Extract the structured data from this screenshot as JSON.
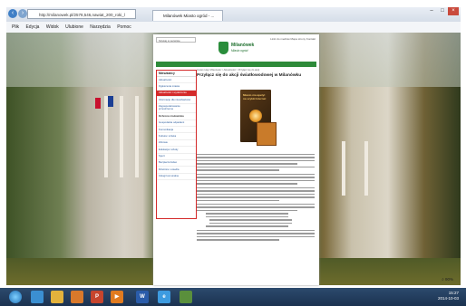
{
  "browser": {
    "address": "http://milanowek.pl/2578,546,nawiat_200_roki_l",
    "tab_title": "Milanówek Miasto ogród - ...",
    "menu": [
      "Plik",
      "Edycja",
      "Widok",
      "Ulubione",
      "Narzędzia",
      "Pomoc"
    ],
    "zoom_label": "⌕ 90%"
  },
  "site": {
    "search_placeholder": "Szukaj w serwisie",
    "top_links": "Linki do mediów   Mapa strony   Kontakt",
    "logo_name": "Milanówek",
    "logo_sub": "Miasto ogród",
    "nav": "Milanówek   Mieszkańcy   Biznes   Turystyka   Kultura i sport   Organizacje pozarządowe   Kontakt",
    "breadcrumb": "Jesteś tutaj: Milanówek > Aktualności > Przyłącz się do akcji",
    "sidebar_title": "Mieszkańcy",
    "sidebar_items": [
      {
        "label": "Aktualności",
        "active": false,
        "cat": false
      },
      {
        "label": "Ogłoszenia miasta",
        "active": false,
        "cat": false
      },
      {
        "label": "Aktualności i wydarzenia",
        "active": true,
        "cat": false
      },
      {
        "label": "Informacje dla mieszkańców",
        "active": false,
        "cat": false
      },
      {
        "label": "Zagospodarowanie przestrzenne",
        "active": false,
        "cat": false
      },
      {
        "label": "Ochrona środowiska",
        "active": false,
        "cat": true
      },
      {
        "label": "Gospodarka odpadami",
        "active": false,
        "cat": false
      },
      {
        "label": "Komunikacja",
        "active": false,
        "cat": false
      },
      {
        "label": "Kultura i sztuka",
        "active": false,
        "cat": false
      },
      {
        "label": "Zdrowie",
        "active": false,
        "cat": false
      },
      {
        "label": "Edukacja i szkoły",
        "active": false,
        "cat": false
      },
      {
        "label": "Sport",
        "active": false,
        "cat": false
      },
      {
        "label": "Bezpieczeństwo",
        "active": false,
        "cat": false
      },
      {
        "label": "Dzielnice i osiedla",
        "active": false,
        "cat": false
      },
      {
        "label": "Usługi komunalne",
        "active": false,
        "cat": false
      }
    ],
    "article_title": "Przyłącz się do akcji światłowodowej w Milanówku",
    "box_label": "Miasto ma apetyt na szybki Internet"
  },
  "taskbar": {
    "time": "15:27",
    "date": "2014-10-03"
  }
}
